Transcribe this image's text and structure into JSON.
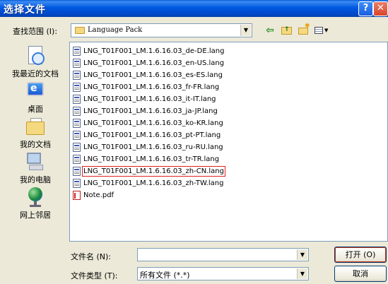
{
  "window": {
    "title": "选择文件",
    "help_icon": "?",
    "close_icon": "✕"
  },
  "toolbar": {
    "look_in_label": "查找范围 (I):",
    "look_in_value": "Language Pack"
  },
  "places": [
    {
      "label": "我最近的文档",
      "icon": "recent-documents-icon"
    },
    {
      "label": "桌面",
      "icon": "desktop-icon"
    },
    {
      "label": "我的文档",
      "icon": "my-documents-icon"
    },
    {
      "label": "我的电脑",
      "icon": "my-computer-icon"
    },
    {
      "label": "网上邻居",
      "icon": "network-places-icon"
    }
  ],
  "files": [
    {
      "name": "LNG_T01F001_LM.1.6.16.03_de-DE.lang",
      "selected": false
    },
    {
      "name": "LNG_T01F001_LM.1.6.16.03_en-US.lang",
      "selected": false
    },
    {
      "name": "LNG_T01F001_LM.1.6.16.03_es-ES.lang",
      "selected": false
    },
    {
      "name": "LNG_T01F001_LM.1.6.16.03_fr-FR.lang",
      "selected": false
    },
    {
      "name": "LNG_T01F001_LM.1.6.16.03_it-IT.lang",
      "selected": false
    },
    {
      "name": "LNG_T01F001_LM.1.6.16.03_ja-JP.lang",
      "selected": false
    },
    {
      "name": "LNG_T01F001_LM.1.6.16.03_ko-KR.lang",
      "selected": false
    },
    {
      "name": "LNG_T01F001_LM.1.6.16.03_pt-PT.lang",
      "selected": false
    },
    {
      "name": "LNG_T01F001_LM.1.6.16.03_ru-RU.lang",
      "selected": false
    },
    {
      "name": "LNG_T01F001_LM.1.6.16.03_tr-TR.lang",
      "selected": false
    },
    {
      "name": "LNG_T01F001_LM.1.6.16.03_zh-CN.lang",
      "selected": true
    },
    {
      "name": "LNG_T01F001_LM.1.6.16.03_zh-TW.lang",
      "selected": false
    },
    {
      "name": "Note.pdf",
      "selected": false
    }
  ],
  "form": {
    "file_name_label": "文件名 (N):",
    "file_name_value": "",
    "file_type_label": "文件类型 (T):",
    "file_type_value": "所有文件 (*.*)",
    "open_label": "打开 (O)",
    "cancel_label": "取消"
  }
}
